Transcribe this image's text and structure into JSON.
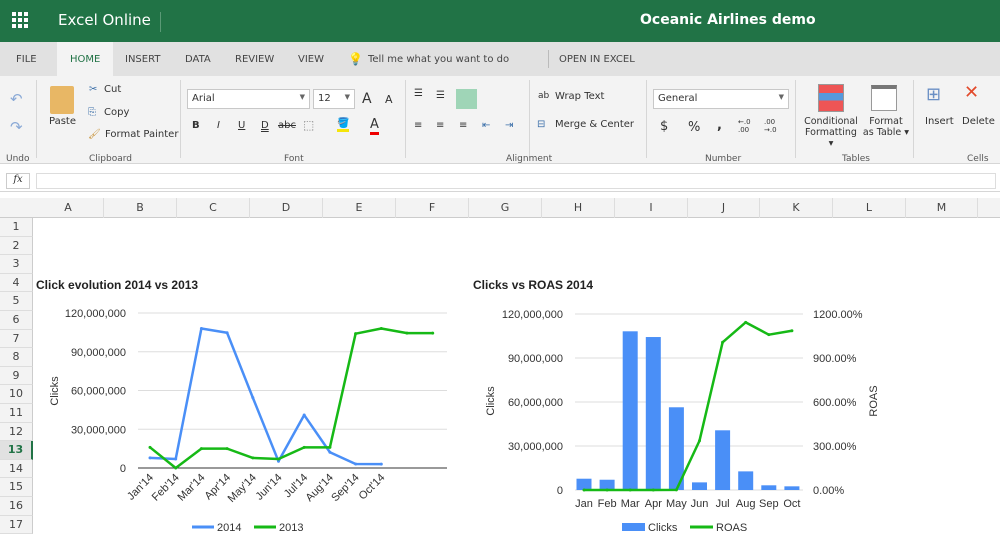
{
  "app": {
    "name": "Excel Online",
    "document_title": "Oceanic Airlines demo"
  },
  "tabs": [
    {
      "label": "FILE"
    },
    {
      "label": "HOME",
      "active": true
    },
    {
      "label": "INSERT"
    },
    {
      "label": "DATA"
    },
    {
      "label": "REVIEW"
    },
    {
      "label": "VIEW"
    }
  ],
  "tell_me": "Tell me what you want to do",
  "open_in_excel": "OPEN IN EXCEL",
  "ribbon": {
    "undo_group": "Undo",
    "clipboard": {
      "group": "Clipboard",
      "paste": "Paste",
      "cut": "Cut",
      "copy": "Copy",
      "format_painter": "Format Painter"
    },
    "font": {
      "group": "Font",
      "family": "Arial",
      "size": "12",
      "bold": "B",
      "italic": "I",
      "underline": "U",
      "double_underline": "D",
      "strike": "abc"
    },
    "alignment": {
      "group": "Alignment",
      "wrap_text": "Wrap Text",
      "merge_center": "Merge & Center"
    },
    "number": {
      "group": "Number",
      "format": "General",
      "currency": "$",
      "percent": "%",
      "comma": ",",
      "inc_dec": "←.0 .00",
      "dec_dec": ".00 →.0"
    },
    "tables": {
      "group": "Tables",
      "conditional_1": "Conditional",
      "conditional_2": "Formatting",
      "format_table_1": "Format",
      "format_table_2": "as Table"
    },
    "cells": {
      "group": "Cells",
      "insert": "Insert",
      "delete": "Delete"
    }
  },
  "formula_bar": {
    "fx": "fx",
    "value": ""
  },
  "columns": [
    "A",
    "B",
    "C",
    "D",
    "E",
    "F",
    "G",
    "H",
    "I",
    "J",
    "K",
    "L",
    "M"
  ],
  "rows": [
    "1",
    "2",
    "3",
    "4",
    "5",
    "6",
    "7",
    "8",
    "9",
    "10",
    "11",
    "12",
    "13",
    "14",
    "15",
    "16",
    "17"
  ],
  "selected_row": "13",
  "colors": {
    "brand": "#217346",
    "blue": "#4a8ff7",
    "green": "#16b916"
  },
  "chart_data": [
    {
      "type": "line",
      "title": "Click evolution 2014 vs 2013",
      "ylabel": "Clicks",
      "xlabel": "",
      "categories": [
        "Jan'14",
        "Feb'14",
        "Mar'14",
        "Apr'14",
        "May'14",
        "Jun'14",
        "Jul'14",
        "Aug'14",
        "Sep'14",
        "Oct'14",
        "",
        ""
      ],
      "yticks": [
        "0",
        "30,000,000",
        "60,000,000",
        "90,000,000",
        "120,000,000"
      ],
      "ylim": [
        0,
        120000000
      ],
      "grid": true,
      "legend": "bottom",
      "series": [
        {
          "name": "2014",
          "color": "#4a8ff7",
          "values": [
            7800000,
            7000000,
            108000000,
            104700000,
            54500000,
            5200000,
            41000000,
            12200000,
            3100000,
            3000000,
            null,
            null
          ]
        },
        {
          "name": "2013",
          "color": "#16b916",
          "values": [
            16000000,
            0,
            15000000,
            15000000,
            7800000,
            7000000,
            16000000,
            16000000,
            104000000,
            108000000,
            104400000,
            104400000
          ]
        }
      ]
    },
    {
      "type": "bar",
      "title": "Clicks vs ROAS 2014",
      "ylabel": "Clicks",
      "y2label": "ROAS",
      "categories": [
        "Jan",
        "Feb",
        "Mar",
        "Apr",
        "May",
        "Jun",
        "Jul",
        "Aug",
        "Sep",
        "Oct"
      ],
      "yticks": [
        "0",
        "30,000,000",
        "60,000,000",
        "90,000,000",
        "120,000,000"
      ],
      "ylim": [
        0,
        120000000
      ],
      "y2ticks": [
        "0.00%",
        "300.00%",
        "600.00%",
        "900.00%",
        "1200.00%"
      ],
      "y2lim": [
        0,
        1200
      ],
      "grid": true,
      "legend": "bottom",
      "series": [
        {
          "name": "Clicks",
          "type": "bar",
          "axis": "left",
          "color": "#4a8ff7",
          "values": [
            7700000,
            7000000,
            108200000,
            104300000,
            56400000,
            5200000,
            40700000,
            12700000,
            3200000,
            2500000
          ]
        },
        {
          "name": "ROAS",
          "type": "line",
          "axis": "right",
          "color": "#16b916",
          "values": [
            0,
            0,
            0,
            0,
            1,
            336,
            1007,
            1143,
            1059,
            1086
          ]
        }
      ]
    }
  ]
}
